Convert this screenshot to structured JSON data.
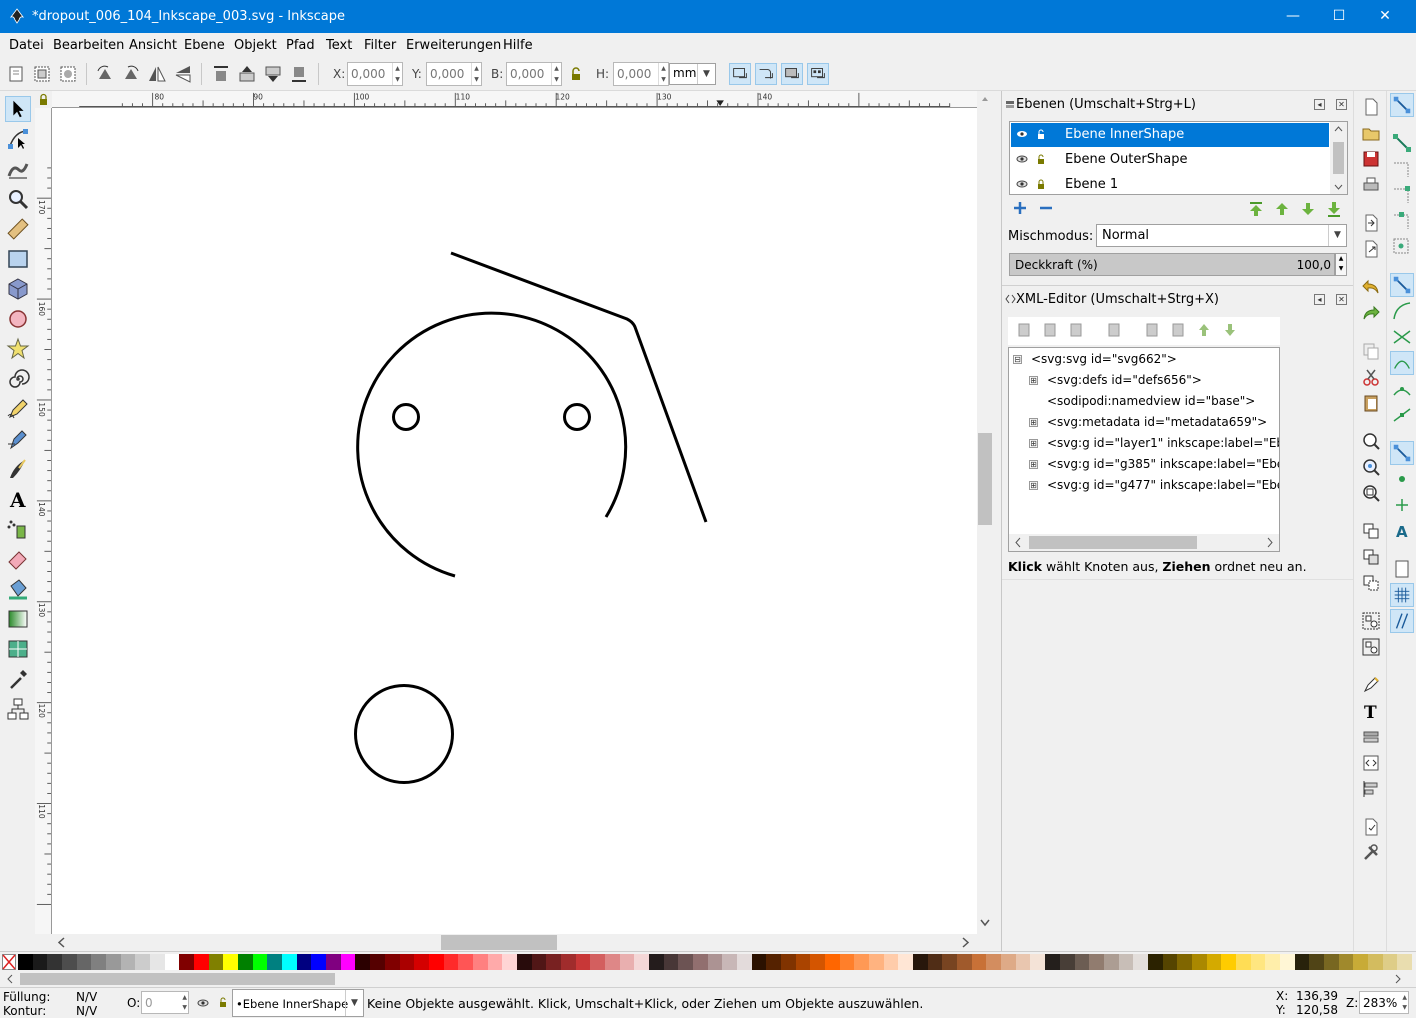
{
  "window": {
    "title": "*dropout_006_104_Inkscape_003.svg - Inkscape",
    "minimize": "—",
    "maximize": "☐",
    "close": "✕"
  },
  "menu": [
    "Datei",
    "Bearbeiten",
    "Ansicht",
    "Ebene",
    "Objekt",
    "Pfad",
    "Text",
    "Filter",
    "Erweiterungen",
    "Hilfe"
  ],
  "toolbar": {
    "x_label": "X:",
    "x_value": "0,000",
    "y_label": "Y:",
    "y_value": "0,000",
    "w_label": "B:",
    "w_value": "0,000",
    "h_label": "H:",
    "h_value": "0,000",
    "unit": "mm"
  },
  "rulers": {
    "h_ticks": [
      "80",
      "90",
      "100",
      "110",
      "120",
      "130",
      "140"
    ],
    "v_ticks": [
      "170",
      "160",
      "150",
      "140",
      "130",
      "120",
      "110"
    ]
  },
  "layers_panel": {
    "title": "Ebenen (Umschalt+Strg+L)",
    "layers": [
      {
        "name": "Ebene InnerShape",
        "selected": true
      },
      {
        "name": "Ebene OuterShape",
        "selected": false
      },
      {
        "name": "Ebene 1",
        "selected": false
      }
    ],
    "blend_label": "Mischmodus:",
    "blend_value": "Normal",
    "opacity_label": "Deckkraft (%)",
    "opacity_value": "100,0"
  },
  "xml_panel": {
    "title": "XML-Editor (Umschalt+Strg+X)",
    "nodes": [
      {
        "text": "<svg:svg id=\"svg662\">",
        "depth": 0,
        "expander": "⊟"
      },
      {
        "text": "<svg:defs id=\"defs656\">",
        "depth": 1,
        "expander": "⊞"
      },
      {
        "text": "<sodipodi:namedview id=\"base\">",
        "depth": 1,
        "expander": ""
      },
      {
        "text": "<svg:metadata id=\"metadata659\">",
        "depth": 1,
        "expander": "⊞"
      },
      {
        "text": "<svg:g id=\"layer1\" inkscape:label=\"Eben",
        "depth": 1,
        "expander": "⊞"
      },
      {
        "text": "<svg:g id=\"g385\" inkscape:label=\"Eben",
        "depth": 1,
        "expander": "⊞"
      },
      {
        "text": "<svg:g id=\"g477\" inkscape:label=\"Eben",
        "depth": 1,
        "expander": "⊞"
      }
    ],
    "hint_b1": "Klick",
    "hint_t1": " wählt Knoten aus, ",
    "hint_b2": "Ziehen",
    "hint_t2": " ordnet neu an."
  },
  "status": {
    "fill_label": "Füllung:",
    "fill_value": "N/V",
    "stroke_label": "Kontur:",
    "stroke_value": "N/V",
    "opacity_label": "O:",
    "opacity_value": "0",
    "layer": "•Ebene InnerShape",
    "message": "Keine Objekte ausgewählt. Klick, Umschalt+Klick, oder Ziehen um Objekte auszuwählen.",
    "x_label": "X:",
    "x_value": "136,39",
    "y_label": "Y:",
    "y_value": "120,58",
    "zoom_label": "Z:",
    "zoom_value": "283%"
  },
  "palette": [
    "#000000",
    "#1a1a1a",
    "#333333",
    "#4d4d4d",
    "#666666",
    "#808080",
    "#999999",
    "#b3b3b3",
    "#cccccc",
    "#e6e6e6",
    "#ffffff",
    "#800000",
    "#ff0000",
    "#808000",
    "#ffff00",
    "#008000",
    "#00ff00",
    "#008080",
    "#00ffff",
    "#000080",
    "#0000ff",
    "#800080",
    "#ff00ff",
    "#2b0000",
    "#550000",
    "#800000",
    "#aa0000",
    "#d40000",
    "#ff0000",
    "#ff2a2a",
    "#ff5555",
    "#ff8080",
    "#ffaaaa",
    "#ffd5d5",
    "#280b0b",
    "#501616",
    "#782121",
    "#a02c2c",
    "#c83737",
    "#d35f5f",
    "#de8787",
    "#e9afaf",
    "#f4d7d7",
    "#241c1c",
    "#483737",
    "#6c5353",
    "#916f6f",
    "#ac9393",
    "#c8b7b7",
    "#e3dbdb",
    "#2b1100",
    "#552200",
    "#803300",
    "#aa4400",
    "#d45500",
    "#ff6600",
    "#ff7f2a",
    "#ff9955",
    "#ffb380",
    "#ffccaa",
    "#ffe6d5",
    "#28170b",
    "#502d16",
    "#784421",
    "#a05a2c",
    "#c87137",
    "#d38d5f",
    "#deaa87",
    "#e9c6af",
    "#f4e3d7",
    "#241f1c",
    "#483e37",
    "#6c5d53",
    "#917c6f",
    "#ac9d93",
    "#c8beb7",
    "#e3dedb",
    "#2b2200",
    "#554400",
    "#806600",
    "#aa8800",
    "#d4aa00",
    "#ffcc00",
    "#ffdd55",
    "#ffe680",
    "#ffeeaa",
    "#fff6d5",
    "#28220b",
    "#504416",
    "#786721",
    "#a0892c",
    "#c8ab37",
    "#d3bc5f",
    "#decd87",
    "#e9ddaf"
  ]
}
